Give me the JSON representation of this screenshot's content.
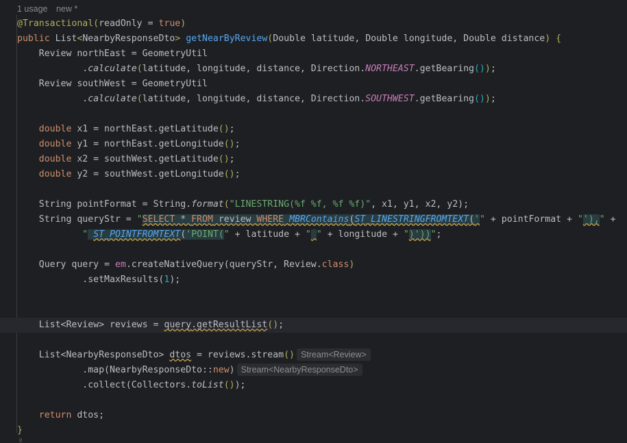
{
  "meta": {
    "usages": "1 usage",
    "author": "new *"
  },
  "code": {
    "annotation": "@Transactional",
    "readonly_param": "readOnly",
    "true_kw": "true",
    "l2_public": "public",
    "l2_type": "List",
    "l2_generic": "NearbyResponseDto",
    "l2_method": "getNearByReview",
    "l2_params": "Double latitude, Double longitude, Double distance",
    "l3": "Review northEast = GeometryUtil",
    "calc": "calculate",
    "calc_args": "latitude, longitude, distance, Direction.",
    "northeast": "NORTHEAST",
    "get_bearing": ".getBearing",
    "l5": "Review southWest = GeometryUtil",
    "southwest": "SOUTHWEST",
    "double_kw": "double",
    "x1": " x1 = northEast.getLatitude",
    "y1": " y1 = northEast.getLongitude",
    "x2": " x2 = southWest.getLatitude",
    "y2": " y2 = southWest.getLongitude",
    "pf_decl": "String pointFormat = String.",
    "format": "format",
    "pf_str": "\"LINESTRING(%f %f, %f %f)\"",
    "pf_args": ", x1, y1, x2, y2);",
    "qs_decl": "String queryStr = ",
    "q_select": "SELECT",
    "q_star": " * ",
    "q_from": "FROM",
    "q_review": " review ",
    "q_where": "WHERE",
    "q_mbr": "MBRContains",
    "q_st_line": "ST_LINESTRINGFROMTEXT",
    "q_plus_pf": " + pointFormat + ",
    "q_close1": "'),",
    "q_plus": " +",
    "q_st_point": "ST_POINTFROMTEXT",
    "q_point": "'POINT(",
    "q_plus_lat": " + latitude + ",
    "q_plus_lng": " + longitude + ",
    "q_close2": ")'))",
    "query_decl": "Query query = ",
    "em": "em",
    "create_native": ".createNativeQuery(queryStr, Review.",
    "class_kw": "class",
    "set_max": ".setMaxResults(",
    "one": "1",
    "reviews_decl": "List<Review> reviews = ",
    "query_var": "query",
    "get_result_list": ".getResultList",
    "dtos_decl": "List<NearbyResponseDto> ",
    "dtos_var": "dtos",
    "stream_call": " = reviews.stream",
    "map_call": ".map(NearbyResponseDto::",
    "new_kw": "new",
    "collect_call": ".collect(Collectors.",
    "to_list": "toList",
    "return_kw": "return",
    "return_val": " dtos;",
    "close_brace": "}"
  },
  "hints": {
    "stream_review": "Stream<Review>",
    "stream_dto": "Stream<NearbyResponseDto>"
  }
}
